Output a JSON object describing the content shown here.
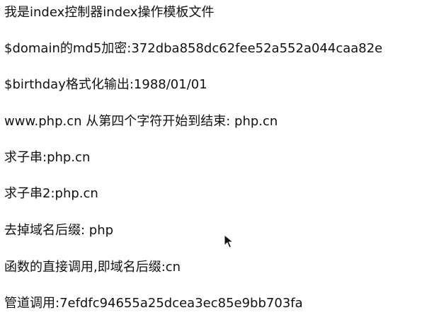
{
  "lines": [
    "我是index控制器index操作模板文件",
    "$domain的md5加密:372dba858dc62fee52a552a044caa82e",
    "$birthday格式化输出:1988/01/01",
    "www.php.cn 从第四个字符开始到结束: php.cn",
    "求子串:php.cn",
    "求子串2:php.cn",
    "去掉域名后缀: php",
    "函数的直接调用,即域名后缀:cn",
    "管道调用:7efdfc94655a25dcea3ec85e9bb703fa"
  ],
  "cursor": {
    "icon": "mouse-pointer-icon"
  }
}
